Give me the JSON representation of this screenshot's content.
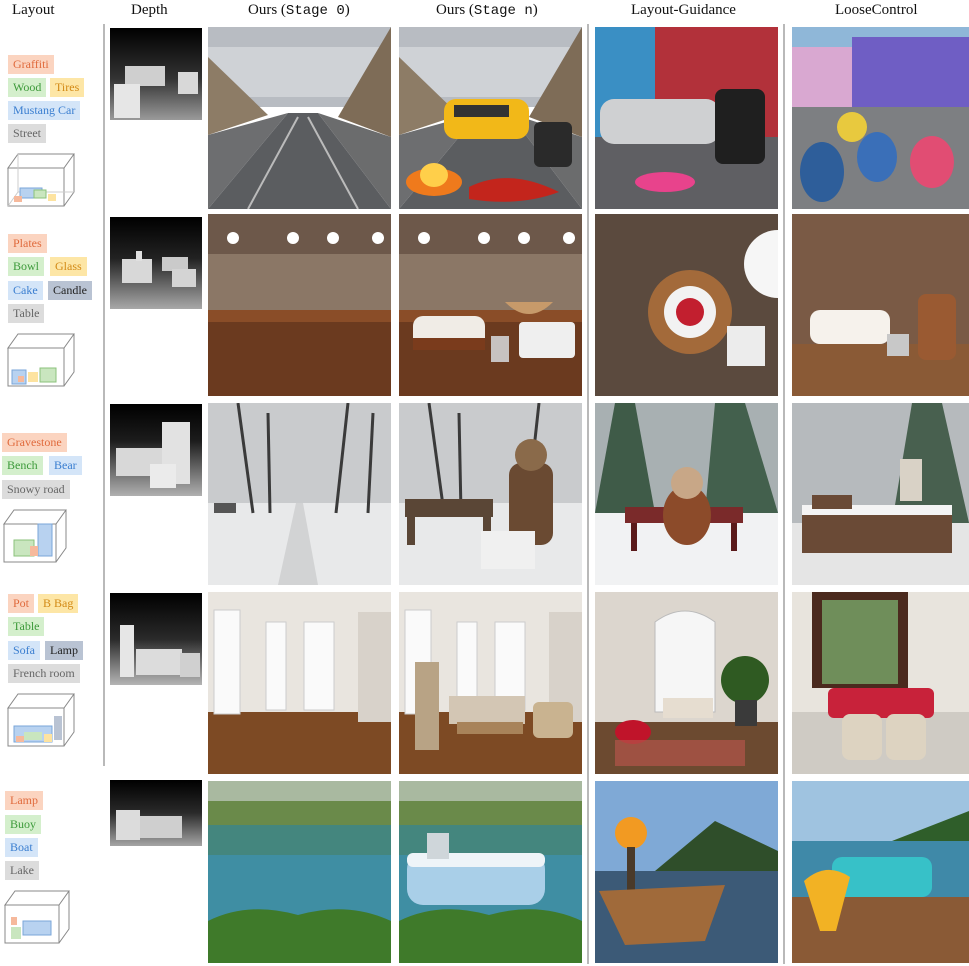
{
  "headers": {
    "layout": "Layout",
    "depth": "Depth",
    "ours_stage0_prefix": "Ours (",
    "ours_stage0_mono": "Stage 0",
    "ours_stage0_suffix": ")",
    "ours_stagen_prefix": "Ours (",
    "ours_stagen_mono": "Stage n",
    "ours_stagen_suffix": ")",
    "layout_guidance": "Layout-Guidance",
    "loosecontrol": "LooseControl"
  },
  "rows": [
    {
      "tags": [
        "Graffiti",
        "Wood",
        "Tires",
        "Mustang Car",
        "Street"
      ],
      "scene": "street"
    },
    {
      "tags": [
        "Plates",
        "Bowl",
        "Glass",
        "Cake",
        "Candle",
        "Table"
      ],
      "scene": "table"
    },
    {
      "tags": [
        "Gravestone",
        "Bench",
        "Bear",
        "Snowy road"
      ],
      "scene": "snow"
    },
    {
      "tags": [
        "Pot",
        "B Bag",
        "Table",
        "Sofa",
        "Lamp",
        "French room"
      ],
      "scene": "room"
    },
    {
      "tags": [
        "Lamp",
        "Buoy",
        "Boat",
        "Lake"
      ],
      "scene": "lake"
    }
  ],
  "colors": {
    "orange_bg": "#fbd4c0",
    "green_bg": "#d4efcc",
    "yellow_bg": "#fde6a6",
    "blue_bg": "#d4e5f8",
    "gray_bg": "#dcdcdc",
    "dark_bg": "#b9c3d3"
  }
}
